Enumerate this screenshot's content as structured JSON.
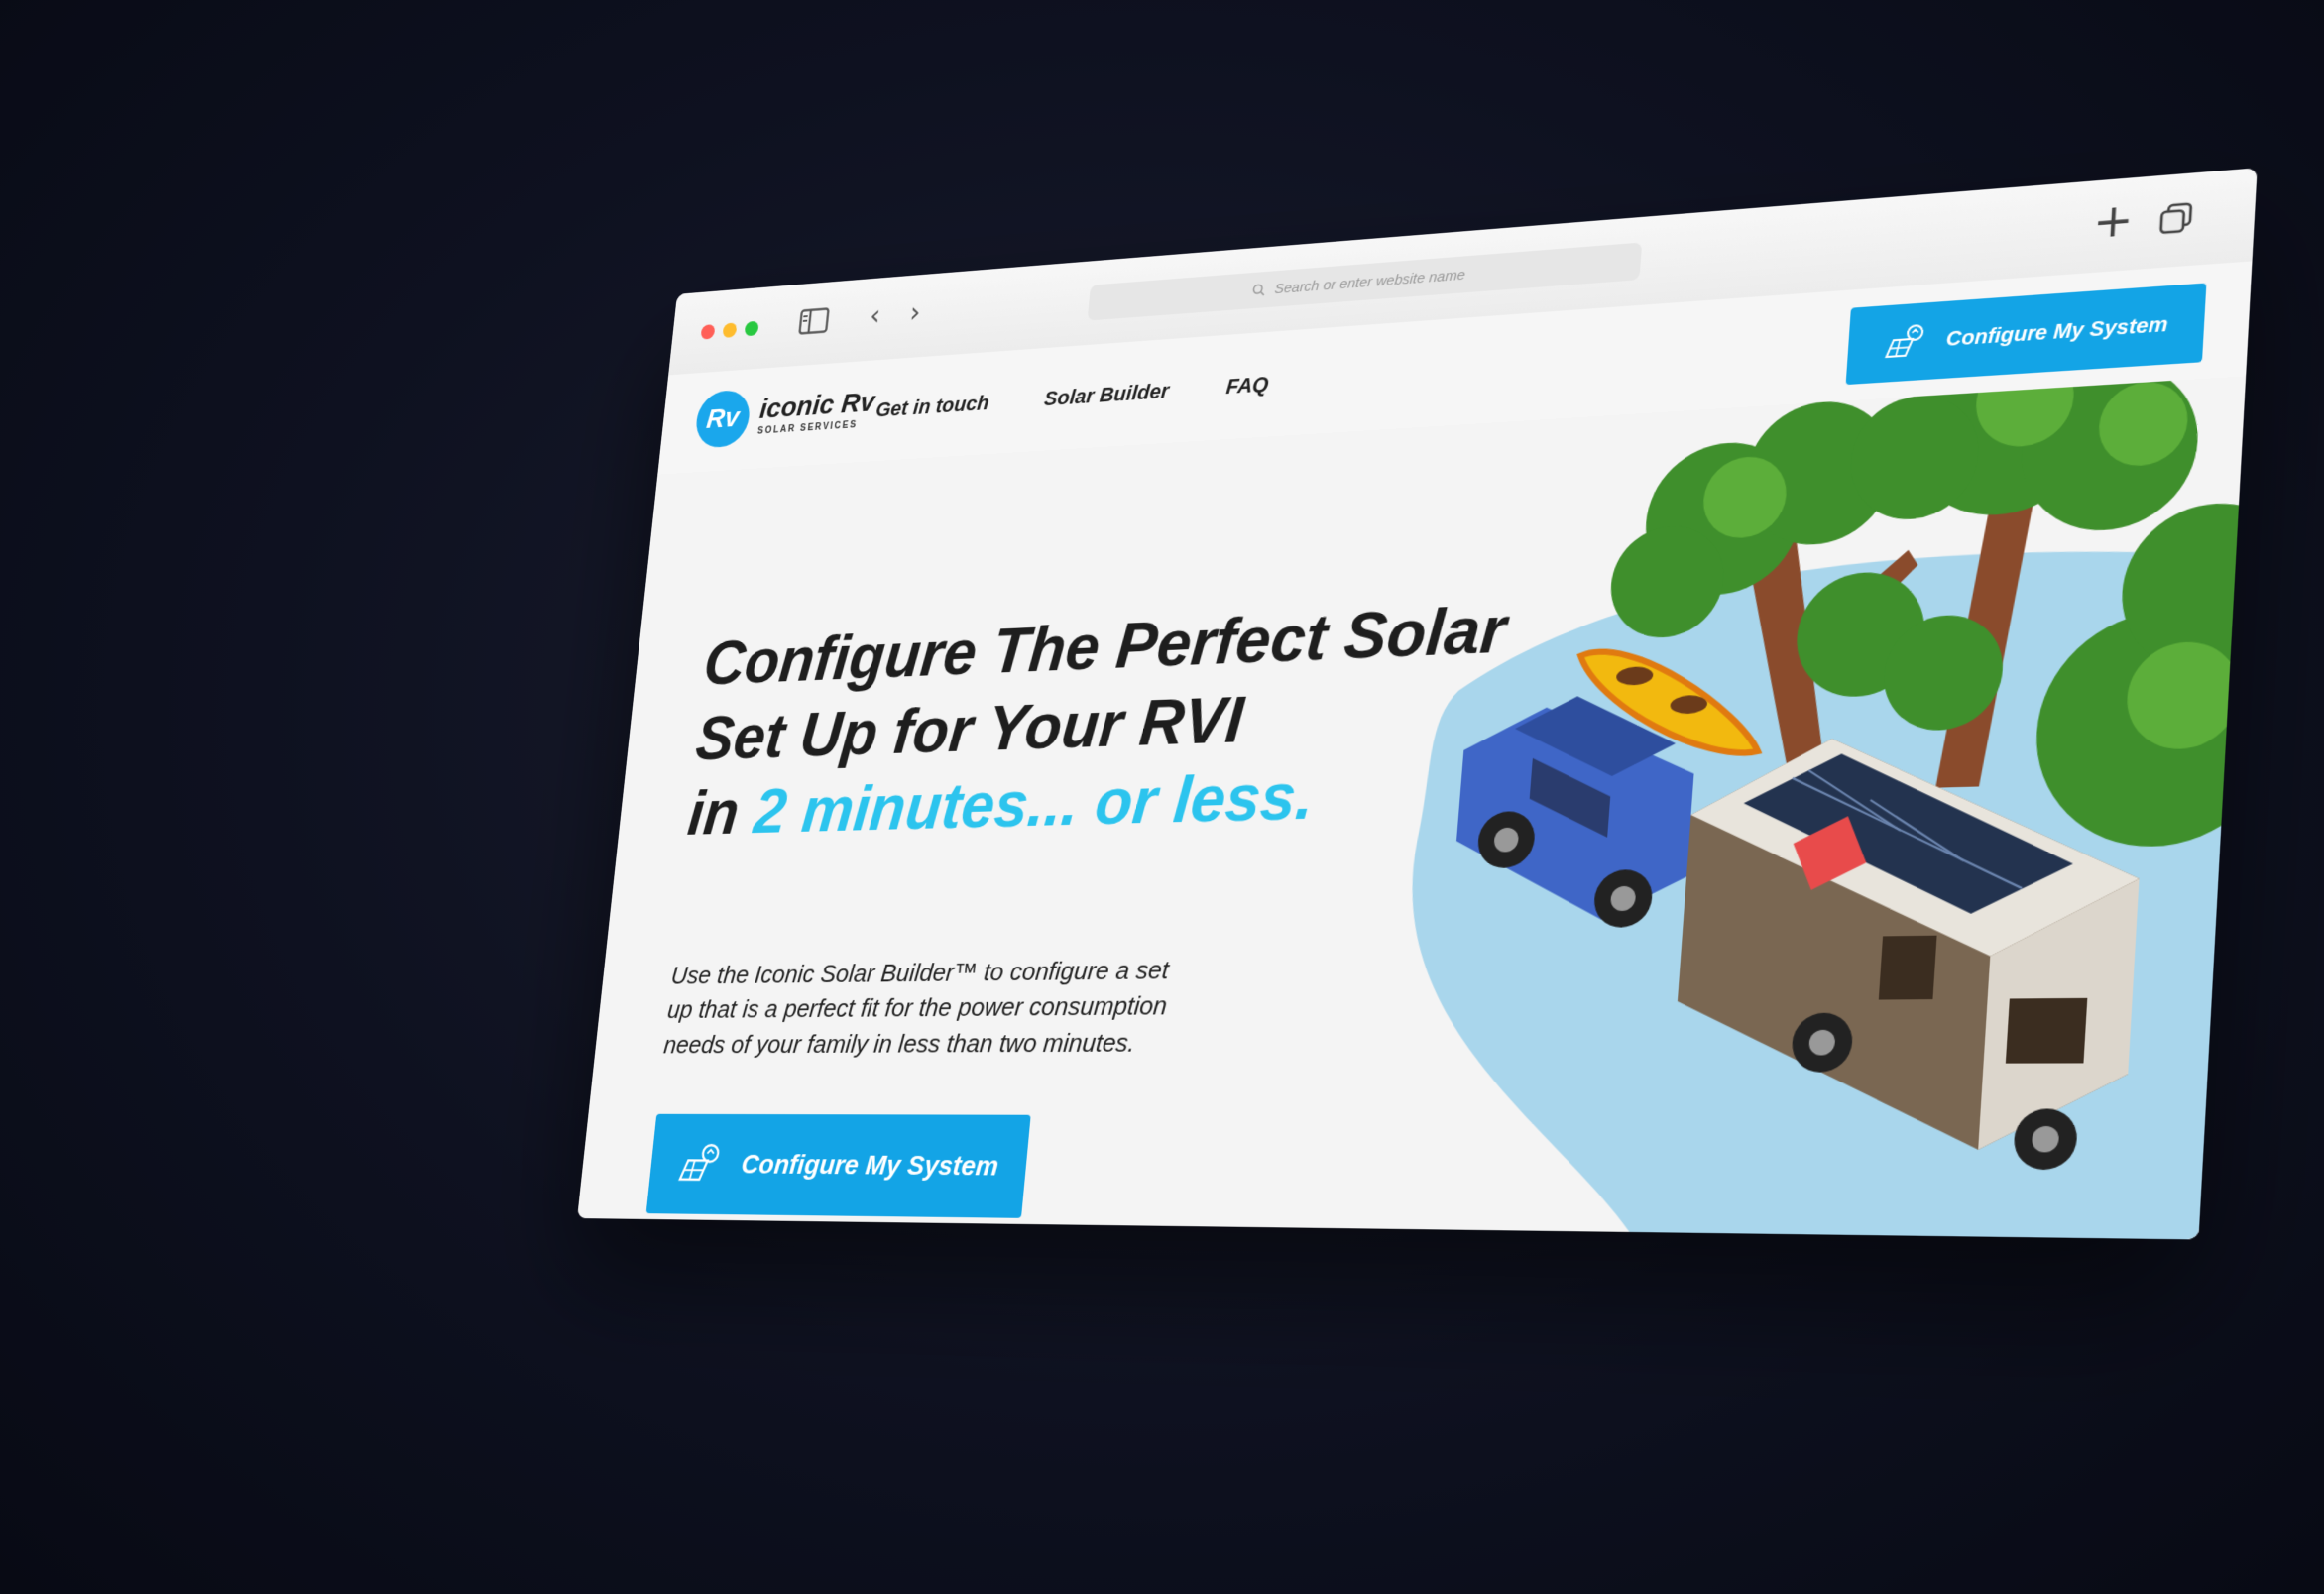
{
  "chrome": {
    "url_placeholder": "Search or enter website name",
    "traffic_lights": [
      "#ff5f57",
      "#febc2e",
      "#28c840"
    ],
    "icons": [
      "sidebar-icon",
      "back-arrow-icon",
      "forward-arrow-icon",
      "search-icon",
      "new-tab-icon",
      "tabs-overview-icon"
    ]
  },
  "site": {
    "logo": {
      "badge": "Rv",
      "name": "iconic Rv",
      "subtitle": "SOLAR SERVICES"
    },
    "nav": [
      "Get in touch",
      "Solar Builder",
      "FAQ"
    ],
    "header_cta": "Configure My System",
    "accent_color": "#13a4e6",
    "highlight_color": "#2cc4ee"
  },
  "hero": {
    "title_line1": "Configure The Perfect Solar",
    "title_line2": "Set Up for Your RVI",
    "title_line3_prefix": "in ",
    "title_line3_accent": "2 minutes... or less.",
    "description": "Use the Iconic Solar Builder™ to configure a set up that is a perfect fit for the power consumption needs of your family in less than two minutes.",
    "cta": "Configure My System"
  }
}
